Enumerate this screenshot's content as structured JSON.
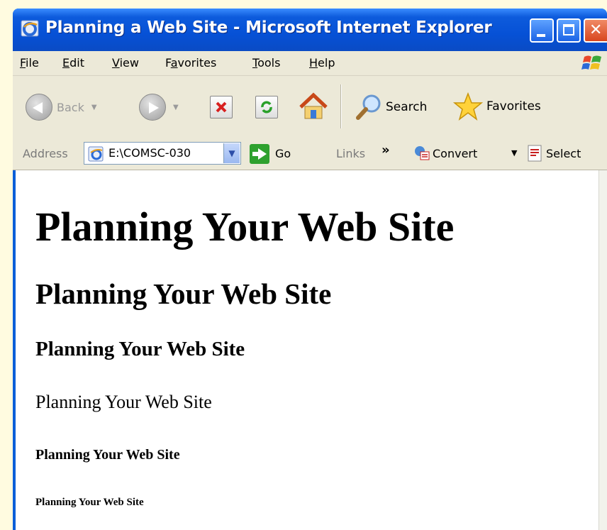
{
  "window": {
    "title": "Planning a Web Site - Microsoft Internet Explorer"
  },
  "menu": {
    "items": [
      "File",
      "Edit",
      "View",
      "Favorites",
      "Tools",
      "Help"
    ],
    "underline_index": [
      0,
      0,
      0,
      1,
      0,
      0
    ]
  },
  "toolbar": {
    "back_label": "Back",
    "search_label": "Search",
    "favorites_label": "Favorites"
  },
  "address": {
    "label": "Address",
    "value": "E:\\COMSC-030",
    "go_label": "Go",
    "links_label": "Links",
    "chevron": "»",
    "convert_label": "Convert",
    "select_label": "Select"
  },
  "page": {
    "h1": "Planning Your Web Site",
    "h2": "Planning Your Web Site",
    "h3": "Planning Your Web Site",
    "h4": "Planning Your Web Site",
    "h5": "Planning Your Web Site",
    "h6": "Planning Your Web Site"
  }
}
